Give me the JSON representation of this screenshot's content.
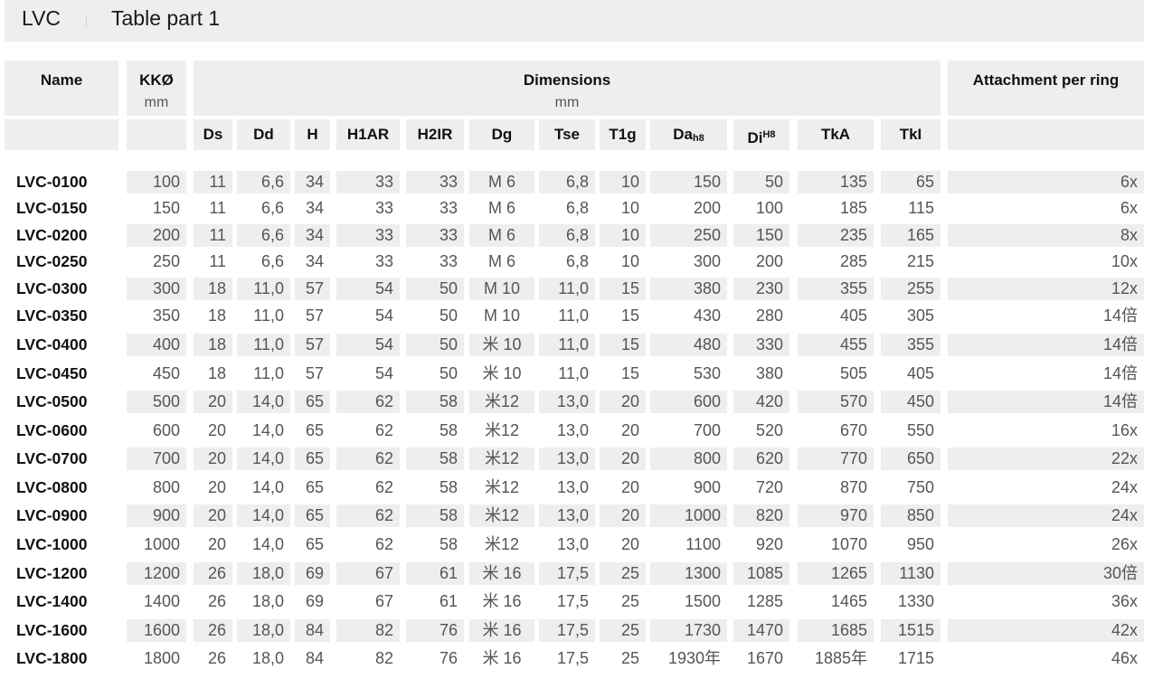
{
  "header": {
    "product": "LVC",
    "table_title": "Table part 1"
  },
  "groups": {
    "name": "Name",
    "kk": "KKØ",
    "kk_unit": "mm",
    "dims": "Dimensions",
    "dims_unit": "mm",
    "attach": "Attachment per ring"
  },
  "columns": [
    {
      "key": "ds",
      "label": "Ds"
    },
    {
      "key": "dd",
      "label": "Dd"
    },
    {
      "key": "h",
      "label": "H"
    },
    {
      "key": "h1ar",
      "label": "H1AR"
    },
    {
      "key": "h2ir",
      "label": "H2IR"
    },
    {
      "key": "dg",
      "label": "Dg"
    },
    {
      "key": "tse",
      "label": "Tse"
    },
    {
      "key": "t1g",
      "label": "T1g"
    },
    {
      "key": "da",
      "label": "Da",
      "sub": "h8"
    },
    {
      "key": "di",
      "label": "Di",
      "sup": "H8"
    },
    {
      "key": "tka",
      "label": "TkA"
    },
    {
      "key": "tki",
      "label": "TkI"
    }
  ],
  "rows": [
    {
      "name": "LVC-0100",
      "kk": "100",
      "ds": "11",
      "dd": "6,6",
      "h": "34",
      "h1ar": "33",
      "h2ir": "33",
      "dg": "M 6",
      "tse": "6,8",
      "t1g": "10",
      "da": "150",
      "di": "50",
      "tka": "135",
      "tki": "65",
      "att": "6x"
    },
    {
      "name": "LVC-0150",
      "kk": "150",
      "ds": "11",
      "dd": "6,6",
      "h": "34",
      "h1ar": "33",
      "h2ir": "33",
      "dg": "M 6",
      "tse": "6,8",
      "t1g": "10",
      "da": "200",
      "di": "100",
      "tka": "185",
      "tki": "115",
      "att": "6x"
    },
    {
      "name": "LVC-0200",
      "kk": "200",
      "ds": "11",
      "dd": "6,6",
      "h": "34",
      "h1ar": "33",
      "h2ir": "33",
      "dg": "M 6",
      "tse": "6,8",
      "t1g": "10",
      "da": "250",
      "di": "150",
      "tka": "235",
      "tki": "165",
      "att": "8x"
    },
    {
      "name": "LVC-0250",
      "kk": "250",
      "ds": "11",
      "dd": "6,6",
      "h": "34",
      "h1ar": "33",
      "h2ir": "33",
      "dg": "M 6",
      "tse": "6,8",
      "t1g": "10",
      "da": "300",
      "di": "200",
      "tka": "285",
      "tki": "215",
      "att": "10x"
    },
    {
      "name": "LVC-0300",
      "kk": "300",
      "ds": "18",
      "dd": "11,0",
      "h": "57",
      "h1ar": "54",
      "h2ir": "50",
      "dg": "M 10",
      "tse": "11,0",
      "t1g": "15",
      "da": "380",
      "di": "230",
      "tka": "355",
      "tki": "255",
      "att": "12x"
    },
    {
      "name": "LVC-0350",
      "kk": "350",
      "ds": "18",
      "dd": "11,0",
      "h": "57",
      "h1ar": "54",
      "h2ir": "50",
      "dg": "M 10",
      "tse": "11,0",
      "t1g": "15",
      "da": "430",
      "di": "280",
      "tka": "405",
      "tki": "305",
      "att": "14倍"
    },
    {
      "name": "LVC-0400",
      "kk": "400",
      "ds": "18",
      "dd": "11,0",
      "h": "57",
      "h1ar": "54",
      "h2ir": "50",
      "dg": "米 10",
      "tse": "11,0",
      "t1g": "15",
      "da": "480",
      "di": "330",
      "tka": "455",
      "tki": "355",
      "att": "14倍"
    },
    {
      "name": "LVC-0450",
      "kk": "450",
      "ds": "18",
      "dd": "11,0",
      "h": "57",
      "h1ar": "54",
      "h2ir": "50",
      "dg": "米 10",
      "tse": "11,0",
      "t1g": "15",
      "da": "530",
      "di": "380",
      "tka": "505",
      "tki": "405",
      "att": "14倍"
    },
    {
      "name": "LVC-0500",
      "kk": "500",
      "ds": "20",
      "dd": "14,0",
      "h": "65",
      "h1ar": "62",
      "h2ir": "58",
      "dg": "米12",
      "tse": "13,0",
      "t1g": "20",
      "da": "600",
      "di": "420",
      "tka": "570",
      "tki": "450",
      "att": "14倍"
    },
    {
      "name": "LVC-0600",
      "kk": "600",
      "ds": "20",
      "dd": "14,0",
      "h": "65",
      "h1ar": "62",
      "h2ir": "58",
      "dg": "米12",
      "tse": "13,0",
      "t1g": "20",
      "da": "700",
      "di": "520",
      "tka": "670",
      "tki": "550",
      "att": "16x"
    },
    {
      "name": "LVC-0700",
      "kk": "700",
      "ds": "20",
      "dd": "14,0",
      "h": "65",
      "h1ar": "62",
      "h2ir": "58",
      "dg": "米12",
      "tse": "13,0",
      "t1g": "20",
      "da": "800",
      "di": "620",
      "tka": "770",
      "tki": "650",
      "att": "22x"
    },
    {
      "name": "LVC-0800",
      "kk": "800",
      "ds": "20",
      "dd": "14,0",
      "h": "65",
      "h1ar": "62",
      "h2ir": "58",
      "dg": "米12",
      "tse": "13,0",
      "t1g": "20",
      "da": "900",
      "di": "720",
      "tka": "870",
      "tki": "750",
      "att": "24x"
    },
    {
      "name": "LVC-0900",
      "kk": "900",
      "ds": "20",
      "dd": "14,0",
      "h": "65",
      "h1ar": "62",
      "h2ir": "58",
      "dg": "米12",
      "tse": "13,0",
      "t1g": "20",
      "da": "1000",
      "di": "820",
      "tka": "970",
      "tki": "850",
      "att": "24x"
    },
    {
      "name": "LVC-1000",
      "kk": "1000",
      "ds": "20",
      "dd": "14,0",
      "h": "65",
      "h1ar": "62",
      "h2ir": "58",
      "dg": "米12",
      "tse": "13,0",
      "t1g": "20",
      "da": "1100",
      "di": "920",
      "tka": "1070",
      "tki": "950",
      "att": "26x"
    },
    {
      "name": "LVC-1200",
      "kk": "1200",
      "ds": "26",
      "dd": "18,0",
      "h": "69",
      "h1ar": "67",
      "h2ir": "61",
      "dg": "米 16",
      "tse": "17,5",
      "t1g": "25",
      "da": "1300",
      "di": "1085",
      "tka": "1265",
      "tki": "1130",
      "att": "30倍"
    },
    {
      "name": "LVC-1400",
      "kk": "1400",
      "ds": "26",
      "dd": "18,0",
      "h": "69",
      "h1ar": "67",
      "h2ir": "61",
      "dg": "米 16",
      "tse": "17,5",
      "t1g": "25",
      "da": "1500",
      "di": "1285",
      "tka": "1465",
      "tki": "1330",
      "att": "36x"
    },
    {
      "name": "LVC-1600",
      "kk": "1600",
      "ds": "26",
      "dd": "18,0",
      "h": "84",
      "h1ar": "82",
      "h2ir": "76",
      "dg": "米 16",
      "tse": "17,5",
      "t1g": "25",
      "da": "1730",
      "di": "1470",
      "tka": "1685",
      "tki": "1515",
      "att": "42x"
    },
    {
      "name": "LVC-1800",
      "kk": "1800",
      "ds": "26",
      "dd": "18,0",
      "h": "84",
      "h1ar": "82",
      "h2ir": "76",
      "dg": "米 16",
      "tse": "17,5",
      "t1g": "25",
      "da": "1930年",
      "di": "1670",
      "tka": "1885年",
      "tki": "1715",
      "att": "46x"
    }
  ]
}
